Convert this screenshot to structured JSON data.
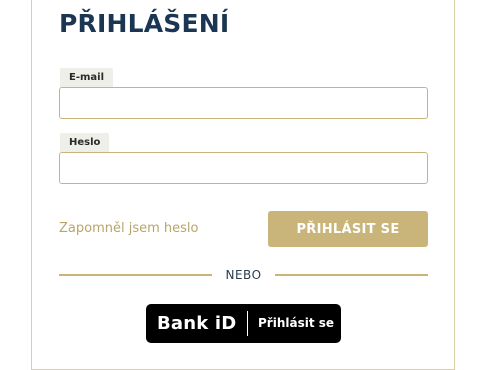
{
  "form": {
    "title": "PŘIHLÁŠENÍ",
    "email": {
      "label": "E-mail",
      "value": "",
      "placeholder": ""
    },
    "password": {
      "label": "Heslo",
      "value": "",
      "placeholder": ""
    },
    "forgot_password": "Zapomněl jsem heslo",
    "login_button": "PŘIHLÁSIT SE",
    "divider_text": "NEBO",
    "bankid": {
      "logo_text": "Bank iD",
      "label": "Přihlásit se"
    }
  },
  "colors": {
    "title": "#1b3653",
    "accent_gold": "#c9b57a",
    "link": "#b9a56a",
    "label_bg": "#efefe9",
    "bankid_bg": "#000000"
  }
}
